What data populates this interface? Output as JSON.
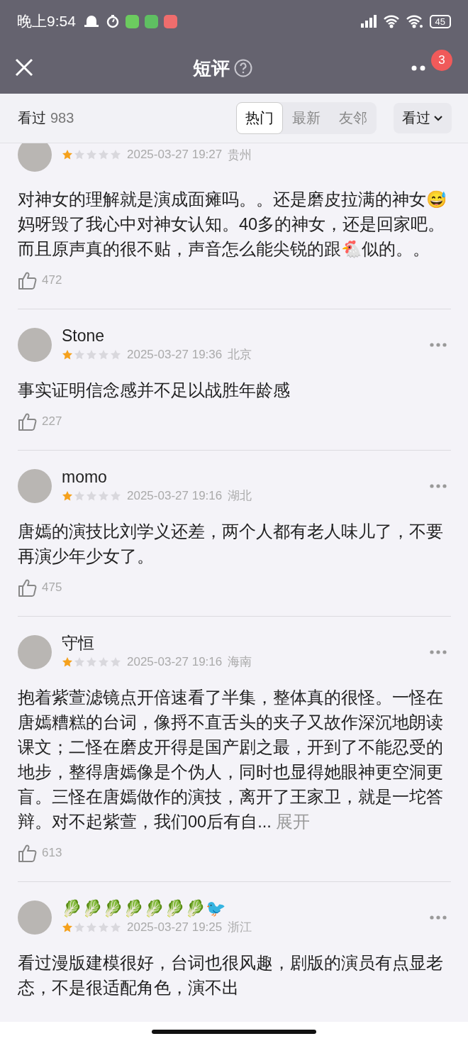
{
  "status_bar": {
    "time": "晚上9:54",
    "battery": "45"
  },
  "nav": {
    "title": "短评",
    "badge": "3"
  },
  "filter": {
    "label": "看过",
    "count": "983",
    "tabs": [
      {
        "label": "热门",
        "selected": true
      },
      {
        "label": "最新",
        "selected": false
      },
      {
        "label": "友邻",
        "selected": false
      }
    ],
    "dropdown": "看过"
  },
  "reviews": [
    {
      "stars": 1,
      "time": "2025-03-27 19:27",
      "location": "贵州",
      "text": "对神女的理解就是演成面瘫吗。。还是磨皮拉满的神女😅妈呀毁了我心中对神女认知。40多的神女，还是回家吧。而且原声真的很不贴，声音怎么能尖锐的跟🐔似的。。",
      "likes": "472"
    },
    {
      "user": "Stone",
      "stars": 1,
      "time": "2025-03-27 19:36",
      "location": "北京",
      "text": "事实证明信念感并不足以战胜年龄感",
      "likes": "227"
    },
    {
      "user": "momo",
      "stars": 1,
      "time": "2025-03-27 19:16",
      "location": "湖北",
      "text": "唐嫣的演技比刘学义还差，两个人都有老人味儿了，不要再演少年少女了。",
      "likes": "475"
    },
    {
      "user": "守恒",
      "stars": 1,
      "time": "2025-03-27 19:16",
      "location": "海南",
      "text": "抱着紫萱滤镜点开倍速看了半集，整体真的很怪。一怪在唐嫣糟糕的台词，像捋不直舌头的夹子又故作深沉地朗读课文；二怪在磨皮开得是国产剧之最，开到了不能忍受的地步，整得唐嫣像是个伪人，同时也显得她眼神更空洞更盲。三怪在唐嫣做作的演技，离开了王家卫，就是一坨答辩。对不起紫萱，我们00后有自...",
      "expand": "展开",
      "likes": "613"
    },
    {
      "user": "🥬🥬🥬🥬🥬🥬🥬🐦",
      "stars": 1,
      "time": "2025-03-27 19:25",
      "location": "浙江",
      "text": "看过漫版建模很好，台词也很风趣，剧版的演员有点显老态，不是很适配角色，演不出"
    }
  ]
}
